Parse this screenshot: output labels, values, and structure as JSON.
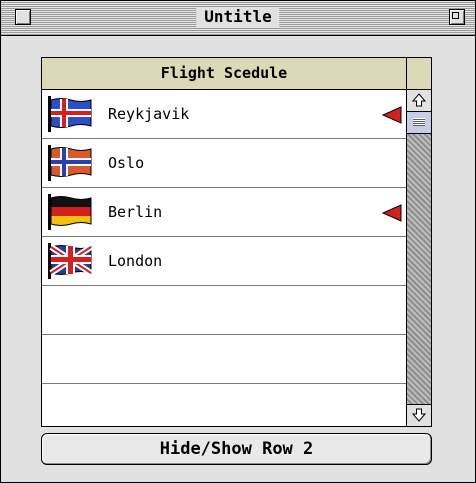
{
  "window": {
    "title": "Untitle"
  },
  "list": {
    "header": "Flight Scedule",
    "rows": [
      {
        "city": "Reykjavik",
        "flag_icon": "iceland-flag-icon",
        "marked": true
      },
      {
        "city": "Oslo",
        "flag_icon": "norway-flag-icon",
        "marked": false
      },
      {
        "city": "Berlin",
        "flag_icon": "germany-flag-icon",
        "marked": true
      },
      {
        "city": "London",
        "flag_icon": "uk-flag-icon",
        "marked": false
      },
      {
        "city": "",
        "flag_icon": "",
        "marked": false
      },
      {
        "city": "",
        "flag_icon": "",
        "marked": false
      },
      {
        "city": "",
        "flag_icon": "",
        "marked": false
      }
    ]
  },
  "button": {
    "label": "Hide/Show Row 2"
  },
  "colors": {
    "header_bg": "#dcd9b8",
    "marker": "#d62020",
    "desktop": "#6f7fb3"
  }
}
